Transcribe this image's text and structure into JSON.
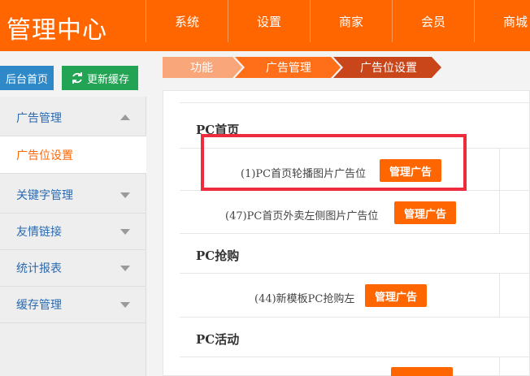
{
  "header": {
    "title": "管理中心",
    "nav": [
      "系统",
      "设置",
      "商家",
      "会员",
      "商城"
    ]
  },
  "quick": {
    "home_label": "后台首页",
    "cache_label": "更新缓存",
    "cache_icon": "refresh-icon"
  },
  "breadcrumb": [
    "功能",
    "广告管理",
    "广告位设置"
  ],
  "sidebar": {
    "items": [
      {
        "label": "广告管理",
        "arrow": "up"
      },
      {
        "label": "广告位设置",
        "active": true
      },
      {
        "label": "关键字管理",
        "arrow": "down"
      },
      {
        "label": "友情链接",
        "arrow": "down"
      },
      {
        "label": "统计报表",
        "arrow": "down"
      },
      {
        "label": "缓存管理",
        "arrow": "down"
      }
    ]
  },
  "sections": [
    {
      "title": "PC首页",
      "ads": [
        {
          "label": "(1)PC首页轮播图片广告位",
          "button": "管理广告"
        },
        {
          "label": "(47)PC首页外卖左侧图片广告位",
          "button": "管理广告"
        }
      ]
    },
    {
      "title": "PC抢购",
      "ads": [
        {
          "label": "(44)新模板PC抢购左",
          "button": "管理广告"
        }
      ]
    },
    {
      "title": "PC活动",
      "ads": [
        {
          "label": "",
          "button": ""
        }
      ]
    }
  ],
  "colors": {
    "brand": "#ff6600",
    "home_button": "#2f89c9",
    "cache_button": "#22a454",
    "highlight": "#ee2c3c",
    "link": "#2a6ab0"
  }
}
